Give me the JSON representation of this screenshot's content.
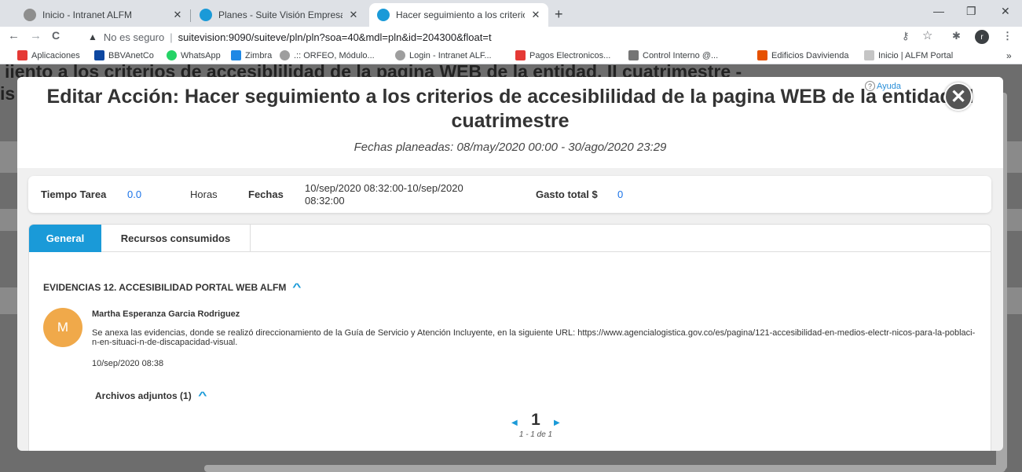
{
  "browser": {
    "tabs": [
      {
        "title": "Inicio - Intranet ALFM",
        "icon_color": "#8e8e8e"
      },
      {
        "title": "Planes - Suite Visión Empresarial",
        "icon_color": "#1a9ad8"
      },
      {
        "title": "Hacer seguimiento a los criterios",
        "icon_color": "#1a9ad8"
      }
    ],
    "close_glyph": "✕",
    "new_tab_glyph": "+",
    "window_controls": [
      "—",
      "❐",
      "✕"
    ],
    "nav": {
      "back": "←",
      "forward": "→",
      "reload": "C"
    },
    "warning_glyph": "▲",
    "security_label": "No es seguro",
    "separator": "|",
    "url": "suitevision:9090/suiteve/pln/pln?soa=40&mdl=pln&id=204300&float=t",
    "toolbar_icons": {
      "key": "⚷",
      "star": "☆",
      "extensions": "✱",
      "profile": "r",
      "menu": "⋮"
    },
    "bookmarks": [
      {
        "label": "Aplicaciones",
        "color": "#e53935"
      },
      {
        "label": "BBVAnetCo",
        "color": "#0d47a1"
      },
      {
        "label": "WhatsApp",
        "color": "#25d366"
      },
      {
        "label": "Zimbra",
        "color": "#1e88e5"
      },
      {
        "label": ".:: ORFEO, Módulo...",
        "color": "#9e9e9e"
      },
      {
        "label": "Login - Intranet ALF...",
        "color": "#9e9e9e"
      },
      {
        "label": "Pagos Electronicos...",
        "color": "#e53935"
      },
      {
        "label": "Control Interno @...",
        "color": "#757575"
      },
      {
        "label": "Edificios Davivienda",
        "color": "#e65100"
      },
      {
        "label": "Inicio | ALFM Portal",
        "color": "#c5c5c5"
      }
    ],
    "bookmarks_more": "»"
  },
  "background": {
    "title_line1": "iiento a los criterios de accesiblilidad de la pagina WEB de la entidad. II cuatrimestre -",
    "title_line2": "is"
  },
  "modal": {
    "title": "Editar Acción: Hacer seguimiento a los criterios de accesiblilidad de la pagina WEB de la entidad. II cuatrimestre",
    "planned_dates": "Fechas planeadas: 08/may/2020 00:00 - 30/ago/2020 23:29",
    "help_label": "Ayuda",
    "help_glyph": "?",
    "close_glyph": "✕",
    "summary": {
      "task_time_label": "Tiempo Tarea",
      "task_time_value": "0.0",
      "hours_label": "Horas",
      "dates_label": "Fechas",
      "dates_value_line1": "10/sep/2020 08:32:00-10/sep/2020",
      "dates_value_line2": "08:32:00",
      "total_cost_label": "Gasto total $",
      "total_cost_value": "0"
    },
    "tabs": [
      "General",
      "Recursos consumidos"
    ],
    "evidence_header": "EVIDENCIAS 12. ACCESIBILIDAD PORTAL WEB ALFM",
    "chevron_glyph": "^",
    "comment": {
      "avatar_initial": "M",
      "author": "Martha Esperanza Garcia Rodriguez",
      "text": "Se anexa las evidencias, donde se realizó direccionamiento de la Guía de Servicio y Atención Incluyente, en la siguiente URL: https://www.agencialogistica.gov.co/es/pagina/121-accesibilidad-en-medios-electr-nicos-para-la-poblaci-n-en-situaci-n-de-discapacidad-visual.",
      "date": "10/sep/2020 08:38"
    },
    "attachments_header": "Archivos adjuntos (1)",
    "pager": {
      "prev": "◀",
      "next": "▶",
      "page": "1",
      "info": "1 - 1 de 1"
    }
  }
}
